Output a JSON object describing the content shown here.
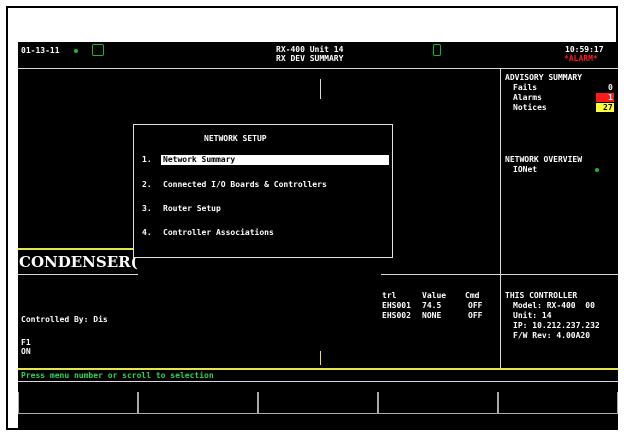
{
  "header": {
    "date": "01-13-11",
    "title_line1": "RX-400 Unit 14",
    "title_line2": "RX DEV SUMMARY",
    "time": "10:59:17",
    "alarm_badge": "*ALARM*",
    "status_color": "#1fb32a",
    "alarm_color": "#ff1a1a"
  },
  "advisory": {
    "title": "ADVISORY SUMMARY",
    "rows": [
      {
        "label": "Fails",
        "value": "0"
      },
      {
        "label": "Alarms",
        "value": "1"
      },
      {
        "label": "Notices",
        "value": "27"
      }
    ],
    "alarms_color": "#ff1a1a",
    "notices_color": "#ffff33"
  },
  "network_overview": {
    "title": "NETWORK OVERVIEW",
    "item": "IONet"
  },
  "dialog": {
    "title": "NETWORK SETUP",
    "items": [
      {
        "num": "1.",
        "label": "Network Summary"
      },
      {
        "num": "2.",
        "label": "Connected I/O Boards & Controllers"
      },
      {
        "num": "3.",
        "label": "Router Setup"
      },
      {
        "num": "4.",
        "label": "Controller Associations"
      }
    ]
  },
  "condenser": {
    "label": "CONDENSER(",
    "controlled_by": "Controlled By: Dis",
    "f1": "F1",
    "on": "ON"
  },
  "points_table": {
    "headers": [
      "trl",
      "Value",
      "Cmd"
    ],
    "rows": [
      [
        "EHS001",
        "74.5",
        "OFF"
      ],
      [
        "EHS002",
        "NONE",
        "OFF"
      ]
    ]
  },
  "this_controller": {
    "title": "THIS CONTROLLER",
    "model": "Model: RX-400  00",
    "unit": "Unit: 14",
    "ip": "IP: 10.212.237.232",
    "fw": "F/W Rev: 4.00A20"
  },
  "prompt": "Press menu number or scroll to selection",
  "prompt_color": "#2fd35a"
}
